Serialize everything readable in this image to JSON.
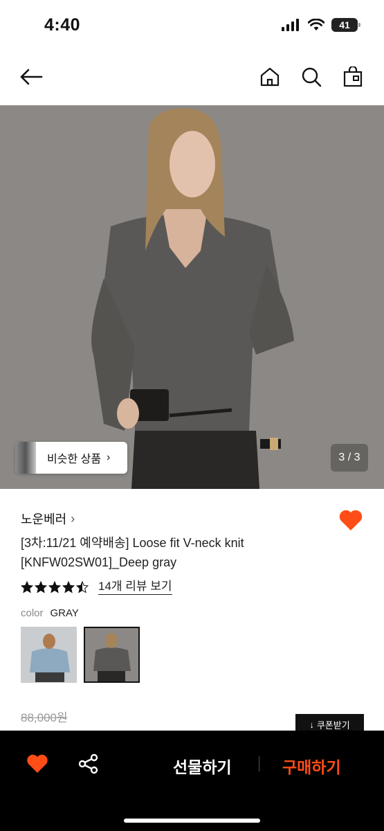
{
  "status": {
    "time": "4:40",
    "battery": "41"
  },
  "header": {
    "back_icon": "arrow-left-icon",
    "home_icon": "home-icon",
    "search_icon": "search-icon",
    "cart_icon": "shopping-bag-icon"
  },
  "hero": {
    "similar_label": "비슷한 상품",
    "pager": "3 / 3"
  },
  "product": {
    "brand": "노운베러",
    "title_line1": "[3차:11/21 예약배송] Loose fit V-neck knit",
    "title_line2": "[KNFW02SW01]_Deep gray",
    "rating": 4.5,
    "review_link": "14개 리뷰 보기",
    "color_label": "color",
    "color_value": "GRAY",
    "price_original": "88,000원",
    "coupon_label": "쿠폰받기"
  },
  "bottom": {
    "gift_label": "선물하기",
    "buy_label": "구매하기"
  },
  "colors": {
    "accent": "#ff4d17",
    "bar_bg": "#000000"
  }
}
